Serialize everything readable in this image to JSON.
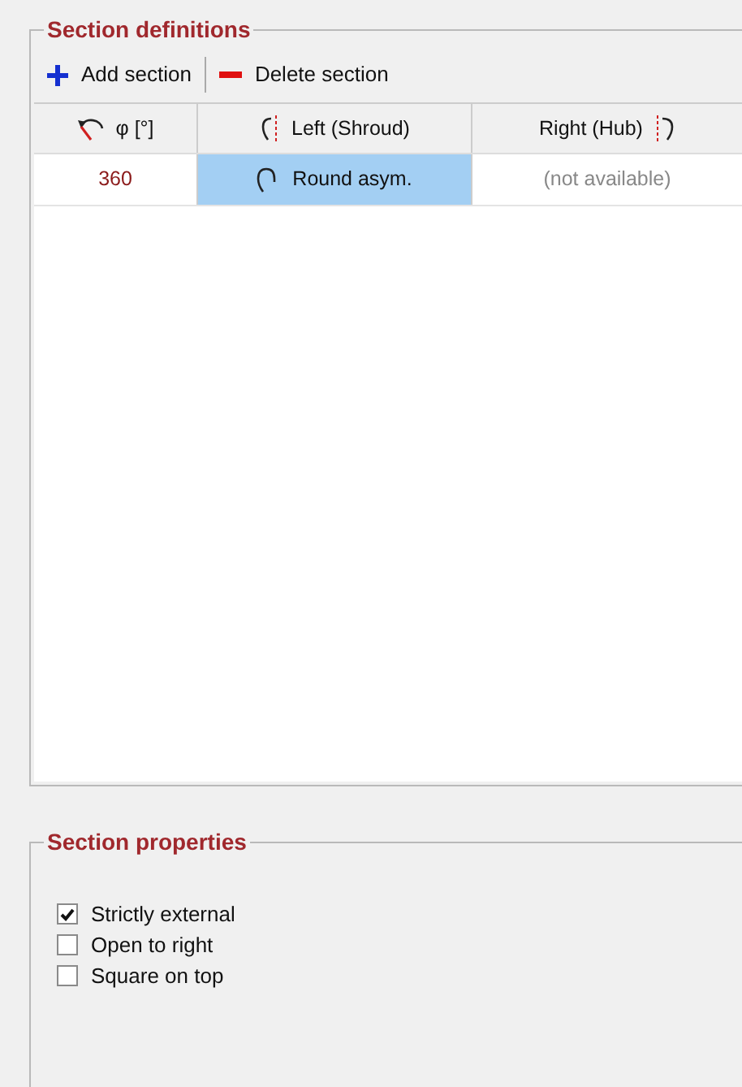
{
  "section_definitions": {
    "title": "Section definitions",
    "toolbar": [
      {
        "kind": "add",
        "label": "Add section"
      },
      {
        "kind": "delete",
        "label": "Delete section"
      }
    ],
    "columns": [
      {
        "kind": "angle",
        "label": "φ [°]"
      },
      {
        "kind": "left",
        "label": "Left (Shroud)"
      },
      {
        "kind": "right",
        "label": "Right (Hub)"
      }
    ],
    "rows": [
      {
        "angle": "360",
        "left": "Round asym.",
        "left_selected": true,
        "right": "(not available)",
        "right_disabled": true
      }
    ]
  },
  "section_properties": {
    "title": "Section properties",
    "options": [
      {
        "label": "Strictly external",
        "checked": true
      },
      {
        "label": "Open to right",
        "checked": false
      },
      {
        "label": "Square on top",
        "checked": false
      }
    ]
  }
}
